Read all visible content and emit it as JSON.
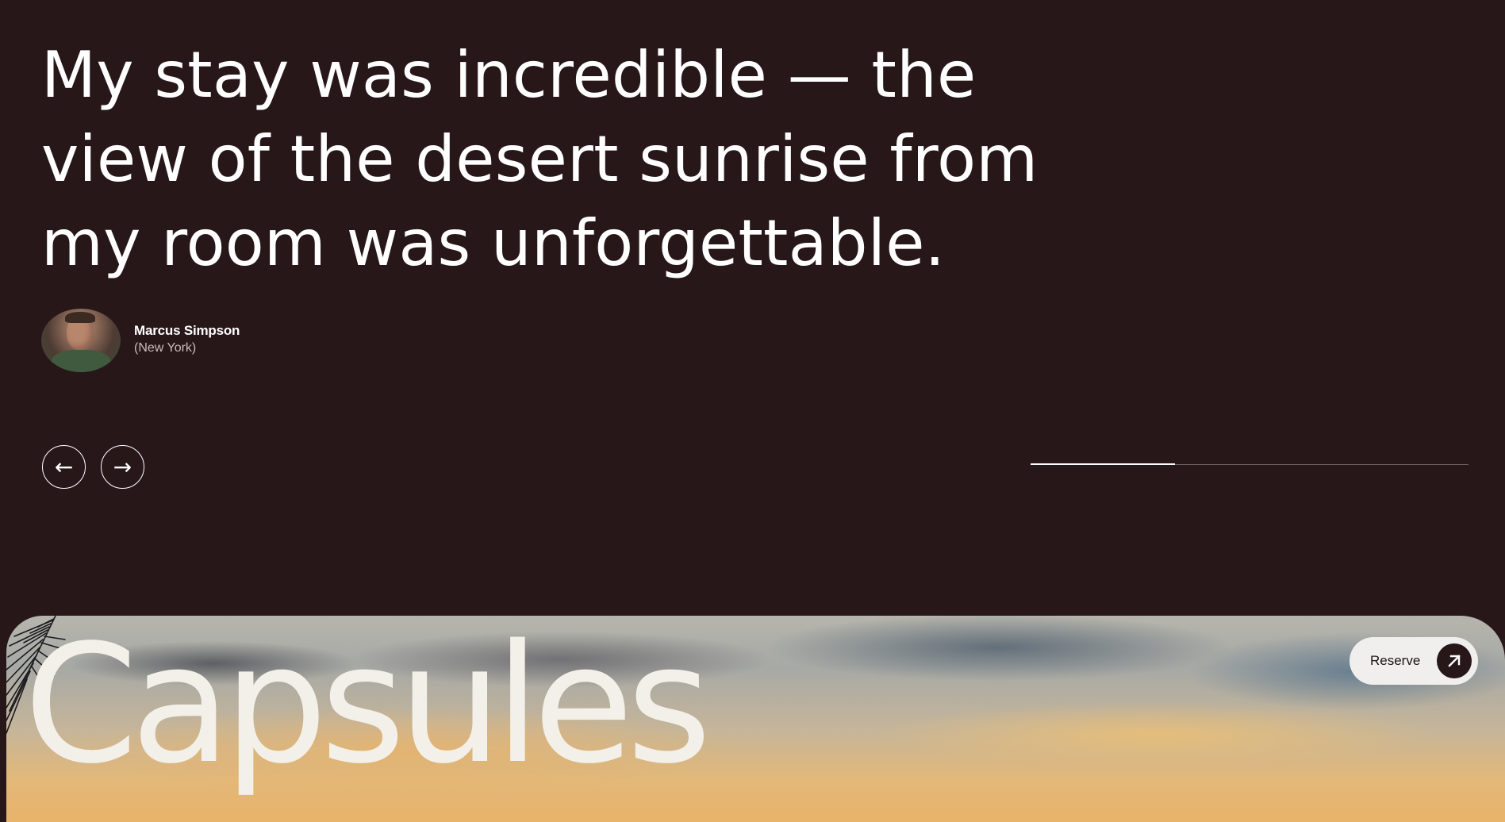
{
  "testimonial": {
    "quote": "My stay was incredible — the view of the desert sunrise from my room was unforgettable.",
    "author_name": "Marcus Simpson",
    "author_location": "(New York)",
    "avatar_icon": "portrait-photo"
  },
  "carousel": {
    "prev_symbol": "←",
    "next_symbol": "→",
    "prev_icon": "arrow-left-icon",
    "next_icon": "arrow-right-icon",
    "progress": 0.33
  },
  "hero": {
    "title": "Capsules",
    "reserve_label": "Reserve",
    "reserve_icon": "arrow-up-right-icon"
  },
  "colors": {
    "background": "#281719",
    "text": "#ffffff",
    "muted_text": "#c9bcbc",
    "button_bg": "#f1efed",
    "hero_title": "#f3efe9"
  }
}
